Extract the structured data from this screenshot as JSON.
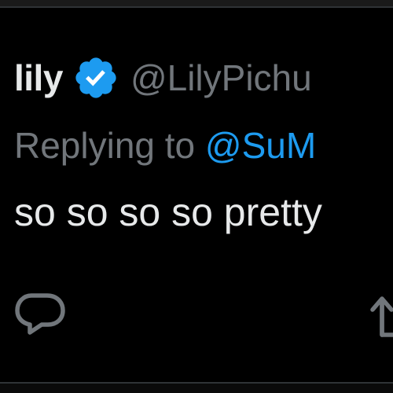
{
  "tweet": {
    "display_name": "lily",
    "handle": "@LilyPichu",
    "reply_prefix": "Replying to ",
    "reply_mention": "@SuM",
    "text": "so so so so pretty"
  },
  "icons": {
    "verified": "verified-badge-icon",
    "reply": "reply-icon",
    "retweet": "retweet-icon"
  },
  "colors": {
    "background": "#000000",
    "text": "#e7e9ea",
    "muted": "#71767b",
    "accent": "#1d9bf0"
  }
}
